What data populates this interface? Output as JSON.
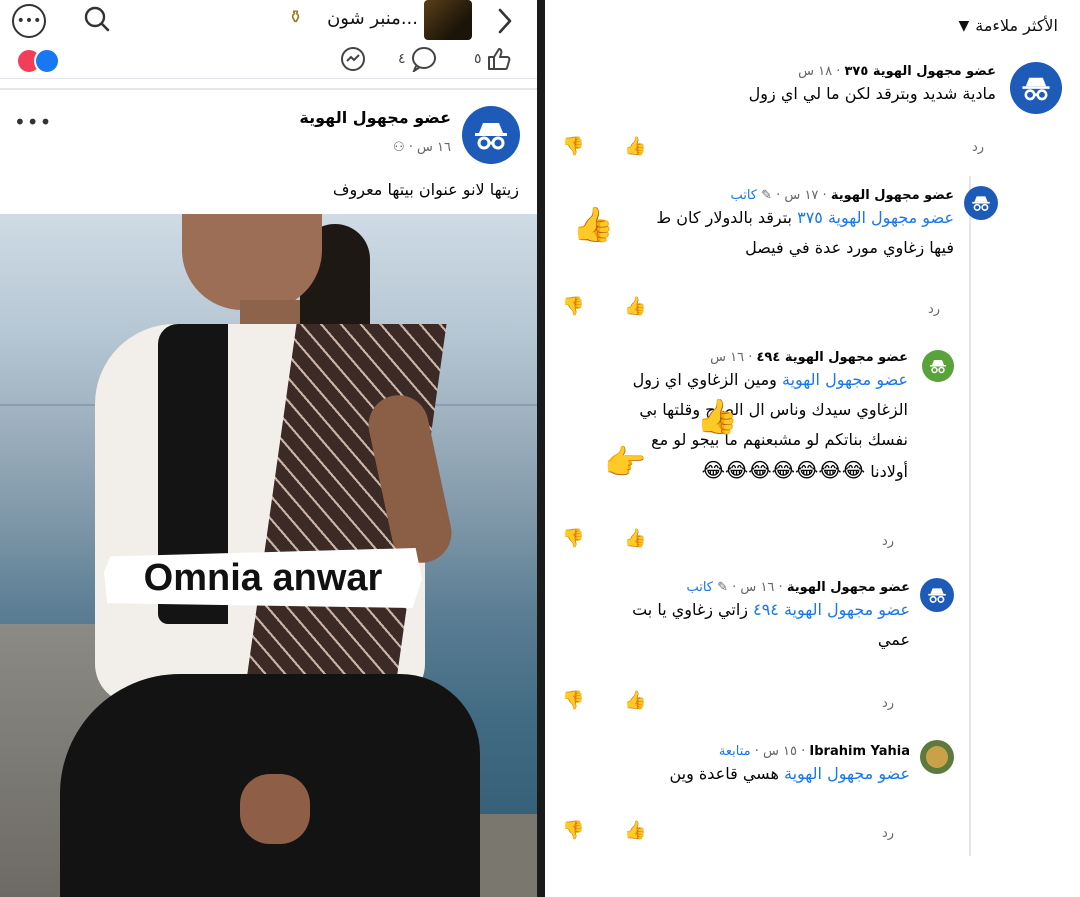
{
  "post_view": {
    "topbar": {
      "page_name": "منبر شون...",
      "more_label": "•••"
    },
    "action_bar": {
      "share_count": "",
      "comment_count": "٤",
      "like_count": "٥"
    },
    "post": {
      "author": "عضو مجهول الهوية",
      "meta": "١٦ س ·",
      "text": "زيتها لانو عنوان بيتها معروف",
      "more_label": "•••",
      "image_watermark": "Omnia anwar"
    }
  },
  "comments_view": {
    "sort_label": "الأكثر ملاءمة",
    "reply_label": "رد",
    "comments": [
      {
        "author": "عضو مجهول الهوية ٣٧٥",
        "time": "· ١٨ س",
        "badge": "",
        "text": "مادية شديد وبترقد لكن ما لي اي زول"
      },
      {
        "author": "عضو مجهول الهوية",
        "time": "· ١٧ س ·",
        "badge": "كاتب",
        "mention": "عضو مجهول الهوية ٣٧٥",
        "text_line1": "بترقد بالدولار كان ط",
        "text_line2": "فيها زغاوي مورد عدة في فيصل"
      },
      {
        "author": "عضو مجهول الهوية ٤٩٤",
        "time": "· ١٦ س",
        "badge": "",
        "mention": "عضو مجهول الهوية",
        "text_line1": "ومين الزغاوي اي زول",
        "text_line2": "الزغاوي سيدك وناس ال الصاح وقلتها بي",
        "text_line3": "نفسك بناتكم لو مشبعنهم ما بيجو لو مع",
        "text_line4": "أولادنا",
        "laughs": "😂😂😂😂😂😂😂"
      },
      {
        "author": "عضو مجهول الهوية",
        "time": "· ١٦ س ·",
        "badge": "كاتب",
        "mention": "عضو مجهول الهوية ٤٩٤",
        "text_line1": "زاتي زغاوي يا بت",
        "text_line2": "عمي"
      },
      {
        "author": "Ibrahim Yahia",
        "time": "· ١٥ س ·",
        "badge": "متابعة",
        "mention": "عضو مجهول الهوية",
        "text_line1": "هسي قاعدة وين"
      }
    ]
  },
  "colors": {
    "link_blue": "#1877f2",
    "avatar_blue": "#1e5bb8",
    "meta_gray": "#65676b"
  }
}
